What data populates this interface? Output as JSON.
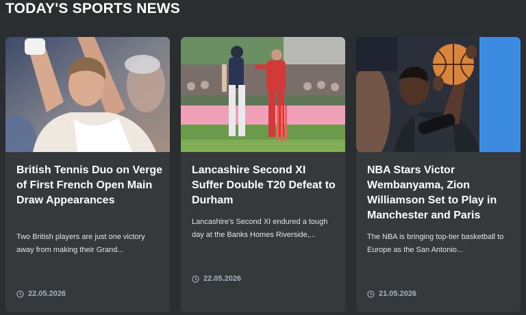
{
  "section": {
    "title": "TODAY'S SPORTS NEWS"
  },
  "articles": [
    {
      "title": "British Tennis Duo on Verge of First French Open Main Draw Appearances",
      "excerpt": "Two British players are just one victory away from making their Grand...",
      "date": "22.05.2026",
      "image_icon": "tennis-player-photo"
    },
    {
      "title": "Lancashire Second XI Suffer Double T20 Defeat to Durham",
      "excerpt": "Lancashire's Second XI endured a tough day at the Banks Homes Riverside,...",
      "date": "22.05.2026",
      "image_icon": "cricket-match-photo"
    },
    {
      "title": "NBA Stars Victor Wembanyama, Zion Williamson Set to Play in Manchester and Paris",
      "excerpt": "The NBA is bringing top-tier basketball to Europe as the San Antonio...",
      "date": "21.05.2026",
      "image_icon": "basketball-player-photo"
    }
  ],
  "colors": {
    "background": "#2b2e30",
    "card": "#35393c",
    "date_text": "#a9b2bc"
  }
}
